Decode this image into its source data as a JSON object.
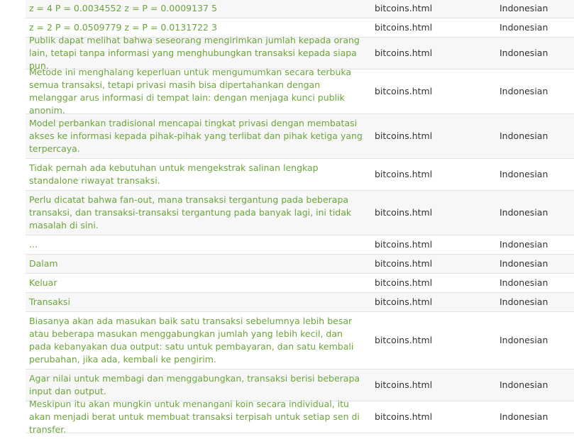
{
  "rows": [
    {
      "text": "z = 4 P = 0.0034552 z = P = 0.0009137 5",
      "file": "bitcoins.html",
      "lang": "Indonesian"
    },
    {
      "text": "z = 2 P = 0.0509779 z = P = 0.0131722 3",
      "file": "bitcoins.html",
      "lang": "Indonesian"
    },
    {
      "text": "Publik dapat melihat bahwa seseorang mengirimkan jumlah kepada orang lain, tetapi tanpa informasi yang menghubungkan transaksi kepada siapa pun.",
      "file": "bitcoins.html",
      "lang": "Indonesian"
    },
    {
      "text": "Metode ini menghalang keperluan untuk mengumumkan secara terbuka semua transaksi, tetapi privasi masih bisa dipertahankan dengan melanggar arus informasi di tempat lain: dengan menjaga kunci publik anonim.",
      "file": "bitcoins.html",
      "lang": "Indonesian"
    },
    {
      "text": "Model perbankan tradisional mencapai tingkat privasi dengan membatasi akses ke informasi kepada pihak-pihak yang terlibat dan pihak ketiga yang terpercaya.",
      "file": "bitcoins.html",
      "lang": "Indonesian"
    },
    {
      "text": "Tidak pernah ada kebutuhan untuk mengekstrak salinan lengkap standalone riwayat transaksi.",
      "file": "bitcoins.html",
      "lang": "Indonesian"
    },
    {
      "text": "Perlu dicatat bahwa fan-out, mana transaksi tergantung pada beberapa transaksi, dan transaksi-transaksi tergantung pada banyak lagi, ini tidak masalah di sini.",
      "file": "bitcoins.html",
      "lang": "Indonesian"
    },
    {
      "text": "...",
      "file": "bitcoins.html",
      "lang": "Indonesian"
    },
    {
      "text": "Dalam",
      "file": "bitcoins.html",
      "lang": "Indonesian"
    },
    {
      "text": "Keluar",
      "file": "bitcoins.html",
      "lang": "Indonesian"
    },
    {
      "text": "Transaksi",
      "file": "bitcoins.html",
      "lang": "Indonesian"
    },
    {
      "text": "Biasanya akan ada masukan baik satu transaksi sebelumnya lebih besar atau beberapa masukan menggabungkan jumlah yang lebih kecil, dan pada kebanyakan dua output: satu untuk pembayaran, dan satu kembali perubahan, jika ada, kembali ke pengirim.",
      "file": "bitcoins.html",
      "lang": "Indonesian"
    },
    {
      "text": "Agar nilai untuk membagi dan menggabungkan, transaksi berisi beberapa input dan output.",
      "file": "bitcoins.html",
      "lang": "Indonesian"
    },
    {
      "text": "Meskipun itu akan mungkin untuk menangani koin secara individual, itu akan menjadi berat untuk membuat transaksi terpisah untuk setiap sen di transfer.",
      "file": "bitcoins.html",
      "lang": "Indonesian"
    }
  ]
}
